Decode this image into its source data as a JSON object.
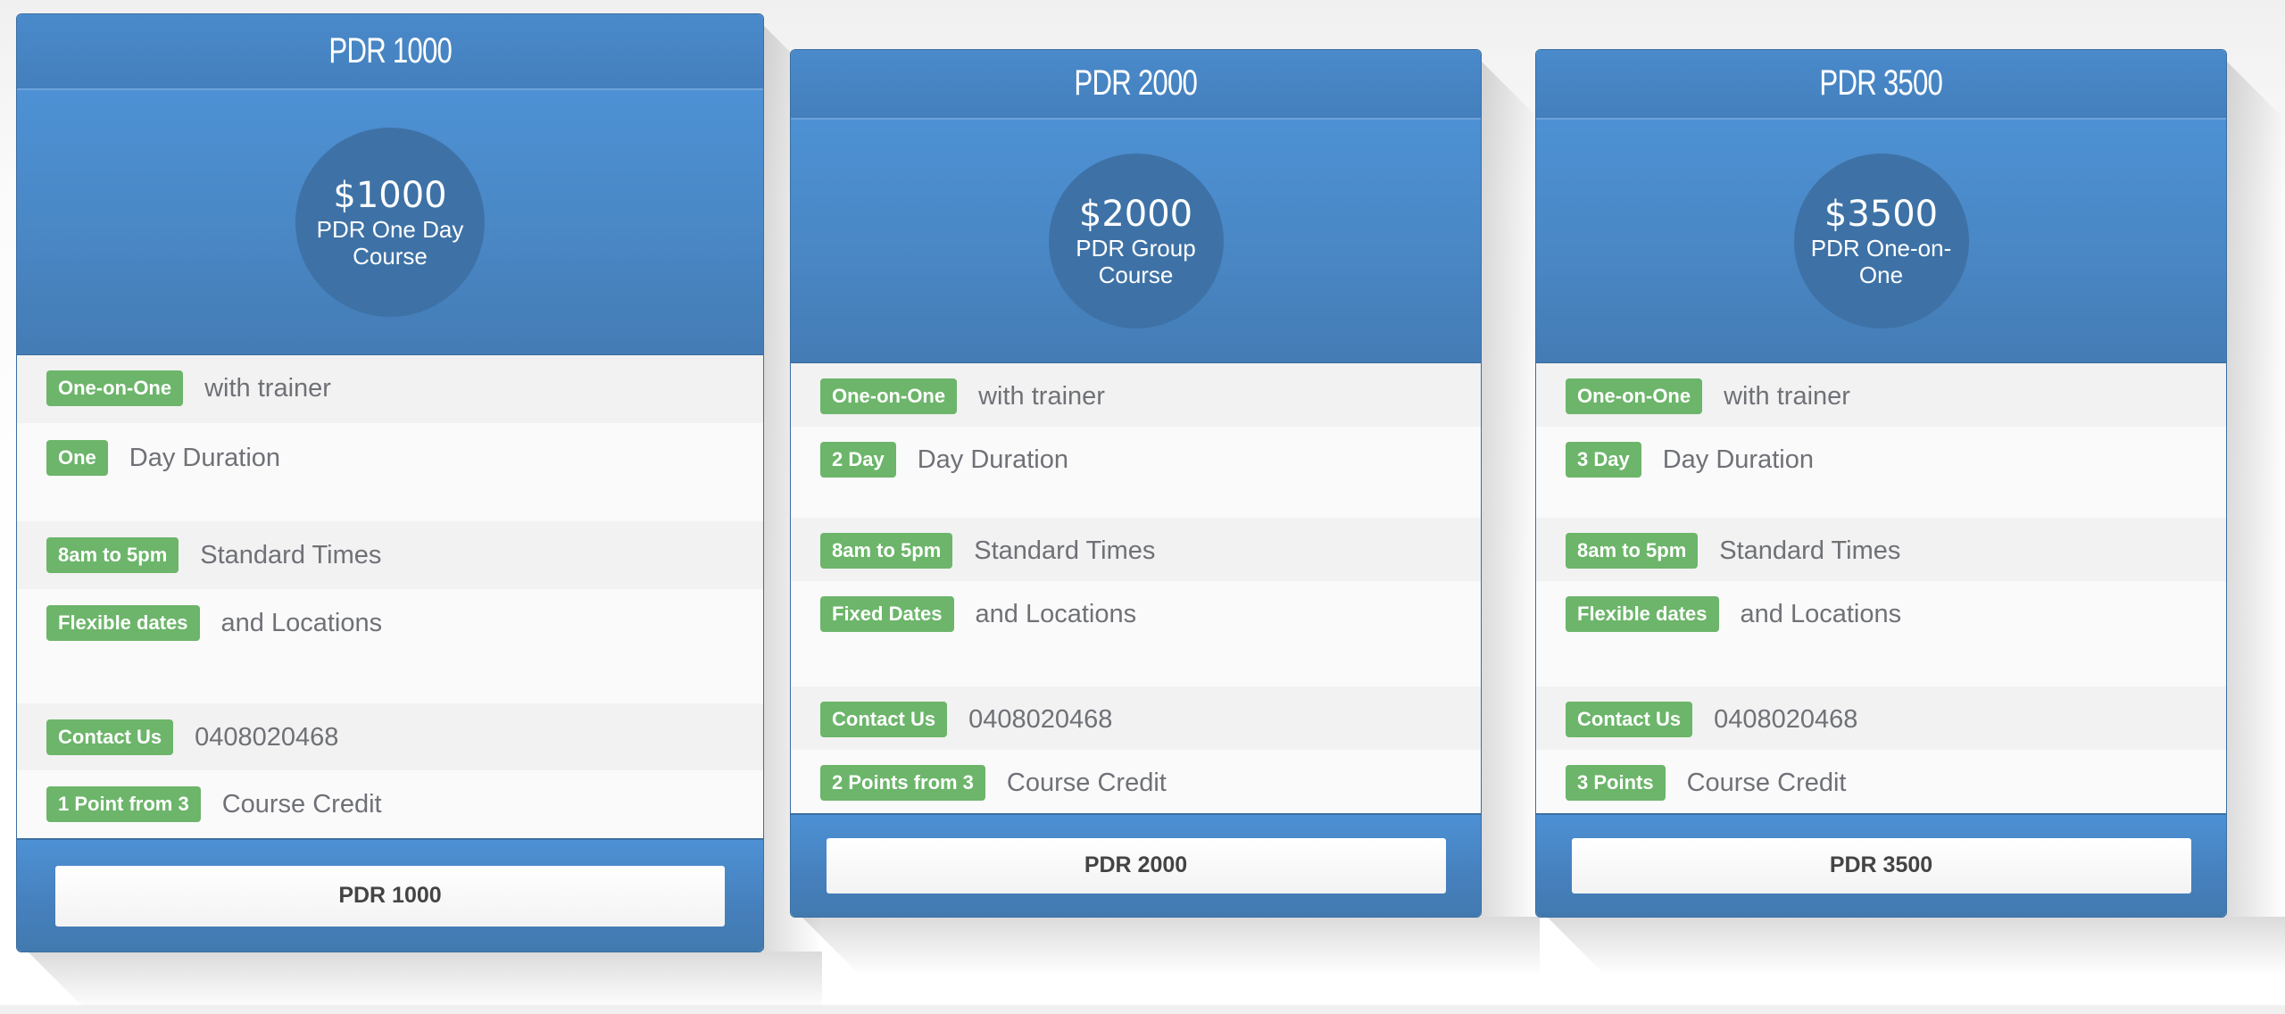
{
  "colors": {
    "header_blue": "#4a8acb",
    "circle_blue": "#3e72a6",
    "badge_green": "#6cb56a",
    "feature_text_gray": "#6f7177",
    "button_text": "#444444"
  },
  "plans": [
    {
      "title": "PDR 1000",
      "price": "$1000",
      "description": "PDR One Day Course",
      "features": [
        {
          "badge": "One-on-One",
          "text": "with trainer"
        },
        {
          "badge": "One",
          "text": "Day Duration"
        },
        {
          "badge": "8am to 5pm",
          "text": "Standard Times"
        },
        {
          "badge": "Flexible dates",
          "text": "and Locations"
        },
        {
          "badge": "Contact Us",
          "text": "0408020468"
        },
        {
          "badge": "1 Point from 3",
          "text": "Course Credit"
        }
      ],
      "button_label": "PDR 1000"
    },
    {
      "title": "PDR 2000",
      "price": "$2000",
      "description": "PDR Group Course",
      "features": [
        {
          "badge": "One-on-One",
          "text": "with trainer"
        },
        {
          "badge": "2 Day",
          "text": "Day Duration"
        },
        {
          "badge": "8am to 5pm",
          "text": "Standard Times"
        },
        {
          "badge": "Fixed Dates",
          "text": "and Locations"
        },
        {
          "badge": "Contact Us",
          "text": "0408020468"
        },
        {
          "badge": "2 Points from 3",
          "text": "Course Credit"
        }
      ],
      "button_label": "PDR 2000"
    },
    {
      "title": "PDR 3500",
      "price": "$3500",
      "description": "PDR One-on-One",
      "features": [
        {
          "badge": "One-on-One",
          "text": "with trainer"
        },
        {
          "badge": "3 Day",
          "text": "Day Duration"
        },
        {
          "badge": "8am to 5pm",
          "text": "Standard Times"
        },
        {
          "badge": "Flexible dates",
          "text": "and Locations"
        },
        {
          "badge": "Contact Us",
          "text": "0408020468"
        },
        {
          "badge": "3 Points",
          "text": "Course Credit"
        }
      ],
      "button_label": "PDR 3500"
    }
  ]
}
